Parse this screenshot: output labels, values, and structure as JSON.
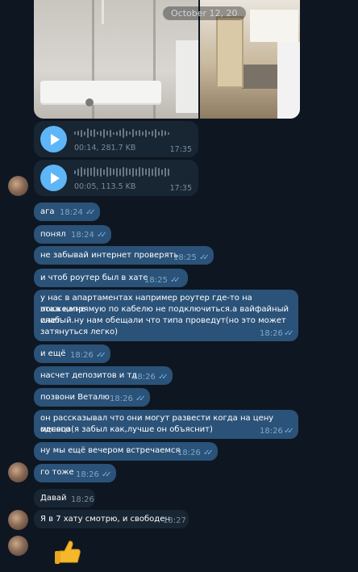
{
  "date_chip": "October 12, 20",
  "voice_messages": [
    {
      "meta": "00:14, 281.7 KB",
      "time": "17:35"
    },
    {
      "meta": "00:05, 113.5 KB",
      "time": "17:35"
    }
  ],
  "messages": [
    {
      "text": "ага",
      "time": "18:24"
    },
    {
      "text": "понял",
      "time": "18:24"
    },
    {
      "text": "не забывай интернет проверять",
      "time": "18:25"
    },
    {
      "text": "и чтоб роутер был в хате",
      "time": "18:25"
    },
    {
      "line1": "у нас в апартаментах  например роутер где-то на этаже,мне",
      "line2": "пока напрямую по кабелю не подключиться.а вайфайный инет",
      "line3": "слабый.ну нам обещали что типа проведут(но это может",
      "line4": "затянуться легко)",
      "time": "18:26"
    },
    {
      "text": "и ещё",
      "time": "18:26"
    },
    {
      "text": "насчет депозитов и тд",
      "time": "18:26"
    },
    {
      "text": "позвони Веталю",
      "time": "18:26"
    },
    {
      "line1": "он рассказывал что они могут развести когда на цену одного",
      "line2": "месяца(я забыл как,лучше он объяснит)",
      "time": "18:26"
    },
    {
      "text": "ну мы ещё вечером встречаемся",
      "time": "18:26"
    },
    {
      "text": "го тоже",
      "time": "18:26"
    }
  ],
  "incoming": [
    {
      "text": "Давай",
      "time": "18:26"
    },
    {
      "text": "Я в 7 хату смотрю, и свободен",
      "time": "18:27"
    }
  ],
  "emoji": "👍"
}
